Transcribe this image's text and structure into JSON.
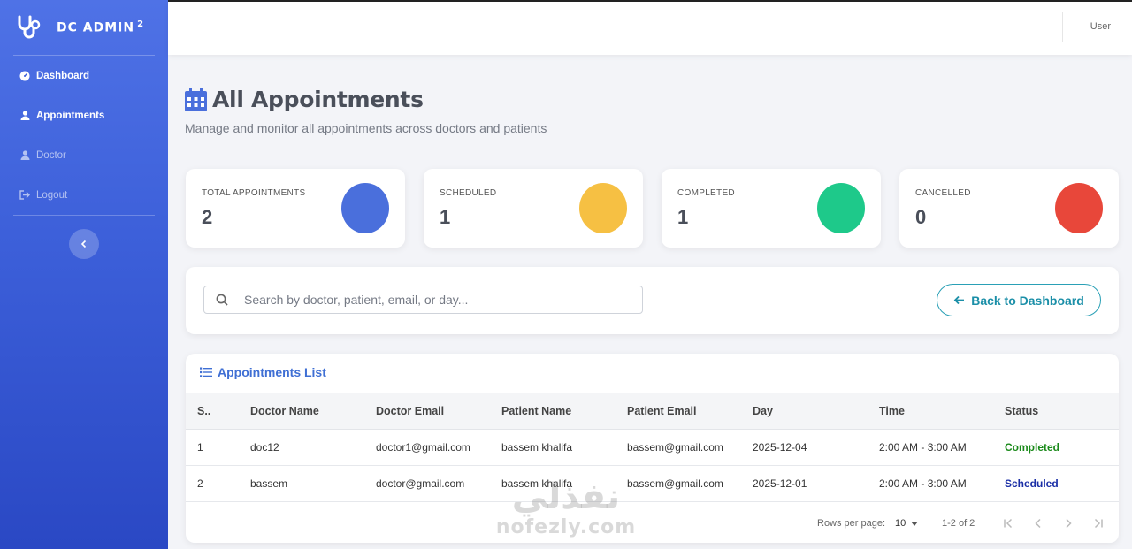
{
  "brand": {
    "name": "DC ADMIN",
    "sup": "2"
  },
  "sidebar": {
    "items": [
      {
        "label": "Dashboard",
        "icon": "gauge-icon"
      },
      {
        "label": "Appointments",
        "icon": "user-icon"
      },
      {
        "label": "Doctor",
        "icon": "user-icon"
      },
      {
        "label": "Logout",
        "icon": "logout-icon"
      }
    ]
  },
  "topbar": {
    "user": "User"
  },
  "header": {
    "title": "All Appointments",
    "subtitle": "Manage and monitor all appointments across doctors and patients"
  },
  "stats": [
    {
      "label": "TOTAL APPOINTMENTS",
      "value": "2",
      "color": "#4a6fdc"
    },
    {
      "label": "SCHEDULED",
      "value": "1",
      "color": "#f6c043"
    },
    {
      "label": "COMPLETED",
      "value": "1",
      "color": "#1ec98a"
    },
    {
      "label": "CANCELLED",
      "value": "0",
      "color": "#e8473a"
    }
  ],
  "search": {
    "placeholder": "Search by doctor, patient, email, or day...",
    "value": ""
  },
  "back_button": "Back to Dashboard",
  "table": {
    "title": "Appointments List",
    "columns": [
      "S..",
      "Doctor Name",
      "Doctor Email",
      "Patient Name",
      "Patient Email",
      "Day",
      "Time",
      "Status"
    ],
    "rows": [
      [
        "1",
        "doc12",
        "doctor1@gmail.com",
        "bassem khalifa",
        "bassem@gmail.com",
        "2025-12-04",
        "2:00 AM - 3:00 AM",
        "Completed"
      ],
      [
        "2",
        "bassem",
        "doctor@gmail.com",
        "bassem khalifa",
        "bassem@gmail.com",
        "2025-12-01",
        "2:00 AM - 3:00 AM",
        "Scheduled"
      ]
    ]
  },
  "pagination": {
    "rows_per_page_label": "Rows per page:",
    "rows_per_page": "10",
    "range": "1-2 of 2"
  },
  "watermark": {
    "arabic": "نفذلي",
    "latin": "nofezly.com"
  }
}
